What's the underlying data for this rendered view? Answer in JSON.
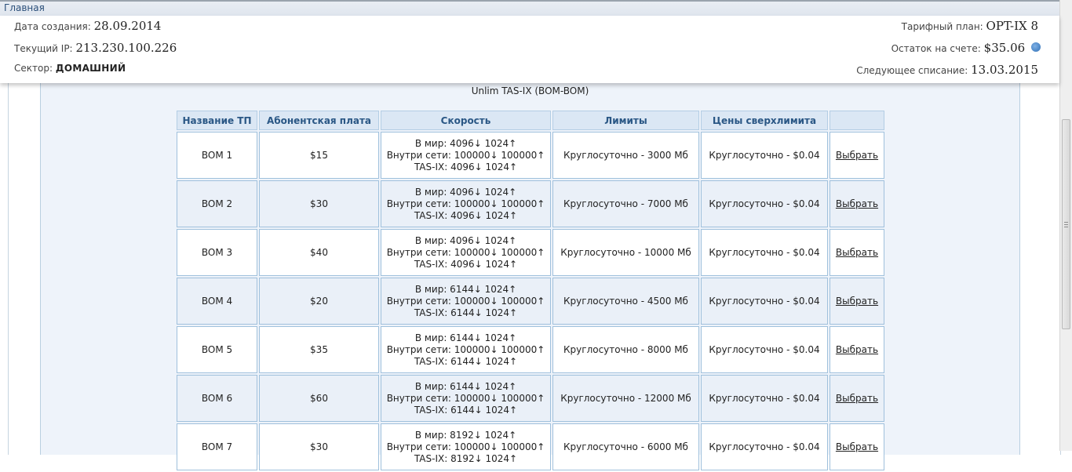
{
  "page": {
    "title": "Главная"
  },
  "account": {
    "created_label": "Дата создания:",
    "created_value": "28.09.2014",
    "ip_label": "Текущий IP:",
    "ip_value": "213.230.100.226",
    "sector_label": "Сектор:",
    "sector_value": "ДОМАШНИЙ",
    "plan_label": "Тарифный план:",
    "plan_value": "OPT-IX 8",
    "balance_label": "Остаток на счете:",
    "balance_value": "$35.06",
    "next_charge_label": "Следующее списание:",
    "next_charge_value": "13.03.2015",
    "refresh_icon": "refresh-icon"
  },
  "tariffs": {
    "caption": "Unlim TAS-IX (BOM-BOM)",
    "headers": [
      "Название ТП",
      "Абонентская плата",
      "Скорость",
      "Лимиты",
      "Цены сверхлимита",
      ""
    ],
    "rows": [
      {
        "name": "BOM 1",
        "fee": "$15",
        "speed": [
          "В мир: 4096↓ 1024↑",
          "Внутри сети: 100000↓ 100000↑",
          "TAS-IX: 4096↓ 1024↑"
        ],
        "limit": "Круглосуточно - 3000 Мб",
        "overlimit": "Круглосуточно - $0.04",
        "action": "Выбрать"
      },
      {
        "name": "BOM 2",
        "fee": "$30",
        "speed": [
          "В мир: 4096↓ 1024↑",
          "Внутри сети: 100000↓ 100000↑",
          "TAS-IX: 4096↓ 1024↑"
        ],
        "limit": "Круглосуточно - 7000 Мб",
        "overlimit": "Круглосуточно - $0.04",
        "action": "Выбрать"
      },
      {
        "name": "BOM 3",
        "fee": "$40",
        "speed": [
          "В мир: 4096↓ 1024↑",
          "Внутри сети: 100000↓ 100000↑",
          "TAS-IX: 4096↓ 1024↑"
        ],
        "limit": "Круглосуточно - 10000 Мб",
        "overlimit": "Круглосуточно - $0.04",
        "action": "Выбрать"
      },
      {
        "name": "BOM 4",
        "fee": "$20",
        "speed": [
          "В мир: 6144↓ 1024↑",
          "Внутри сети: 100000↓ 100000↑",
          "TAS-IX: 6144↓ 1024↑"
        ],
        "limit": "Круглосуточно - 4500 Мб",
        "overlimit": "Круглосуточно - $0.04",
        "action": "Выбрать"
      },
      {
        "name": "BOM 5",
        "fee": "$35",
        "speed": [
          "В мир: 6144↓ 1024↑",
          "Внутри сети: 100000↓ 100000↑",
          "TAS-IX: 6144↓ 1024↑"
        ],
        "limit": "Круглосуточно - 8000 Мб",
        "overlimit": "Круглосуточно - $0.04",
        "action": "Выбрать"
      },
      {
        "name": "BOM 6",
        "fee": "$60",
        "speed": [
          "В мир: 6144↓ 1024↑",
          "Внутри сети: 100000↓ 100000↑",
          "TAS-IX: 6144↓ 1024↑"
        ],
        "limit": "Круглосуточно - 12000 Мб",
        "overlimit": "Круглосуточно - $0.04",
        "action": "Выбрать"
      },
      {
        "name": "BOM 7",
        "fee": "$30",
        "speed": [
          "В мир: 8192↓ 1024↑",
          "Внутри сети: 100000↓ 100000↑",
          "TAS-IX: 8192↓ 1024↑"
        ],
        "limit": "Круглосуточно - 6000 Мб",
        "overlimit": "Круглосуточно - $0.04",
        "action": "Выбрать"
      }
    ]
  }
}
